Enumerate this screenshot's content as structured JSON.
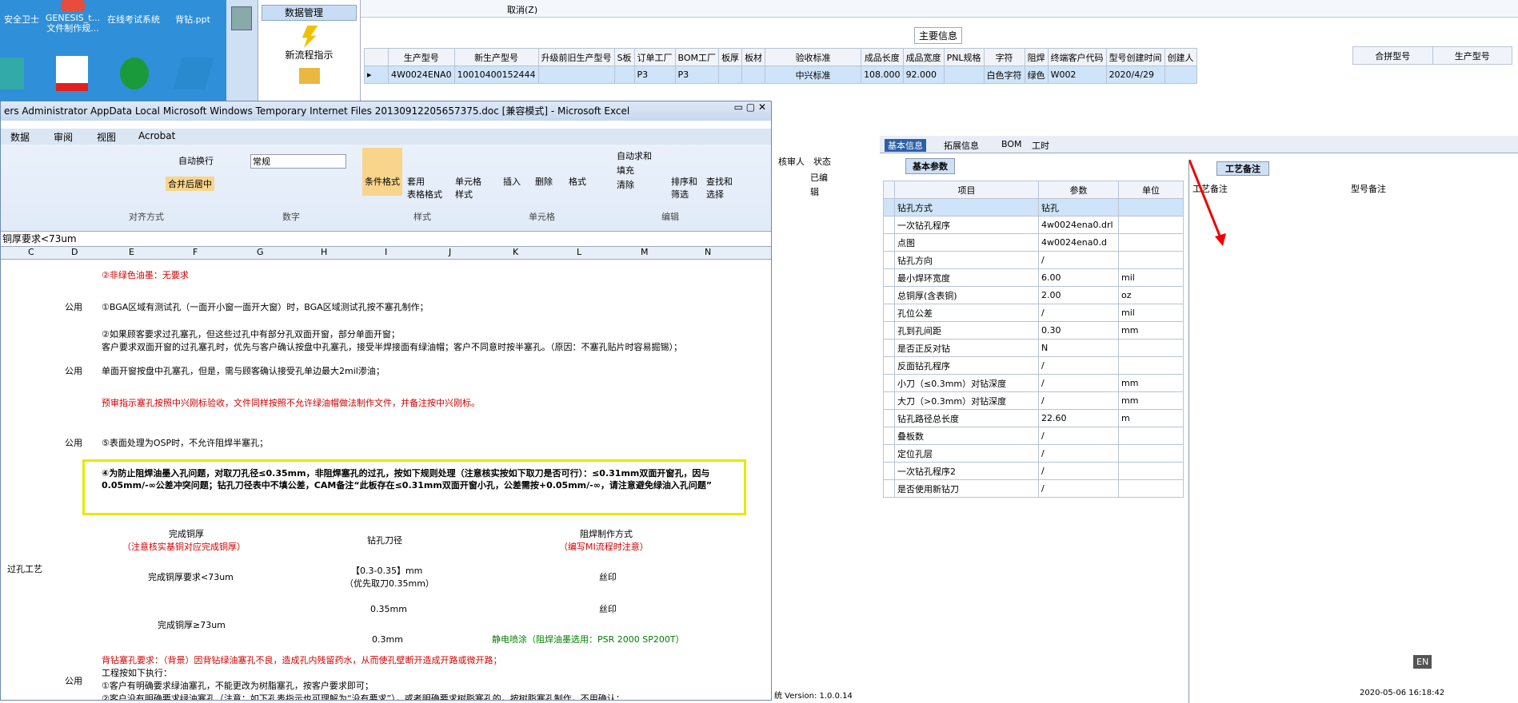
{
  "desktop": {
    "icons": [
      {
        "label": "安全卫士"
      },
      {
        "label": "GENESIS_t... 文件制作规..."
      },
      {
        "label": "在线考试系统"
      },
      {
        "label": "背钻.ppt"
      }
    ]
  },
  "left_panel": {
    "title": "数据管理",
    "item1": "新流程指示"
  },
  "toolbar": {
    "cancel": "取消(Z)"
  },
  "main": {
    "section_title": "主要信息",
    "columns": [
      "生产型号",
      "新生产型号",
      "升级前旧生产型号",
      "S板",
      "订单工厂",
      "BOM工厂",
      "板厚",
      "板材",
      "验收标准",
      "成品长度",
      "成品宽度",
      "PNL规格",
      "字符",
      "阻焊",
      "终端客户代码",
      "型号创建时间",
      "创建人"
    ],
    "row": [
      "4W0024ENA0",
      "10010400152444",
      "",
      "",
      "P3",
      "P3",
      "",
      "",
      "中兴标准",
      "108.000",
      "92.000",
      "",
      "白色字符",
      "绿色",
      "W002",
      "2020/4/29",
      ""
    ],
    "right_columns": [
      "合拼型号",
      "生产型号"
    ]
  },
  "excel": {
    "title": "ers Administrator AppData Local Microsoft Windows Temporary Internet Files 20130912205657375.doc [兼容模式] - Microsoft Excel",
    "menu": [
      "数据",
      "审阅",
      "视图",
      "Acrobat"
    ],
    "ribbon": {
      "wrap": "自动换行",
      "merge": "合并后居中",
      "align_group": "对齐方式",
      "number_format": "常规",
      "number_group": "数字",
      "cond_format": "条件格式",
      "table_format": "套用\n表格格式",
      "cell_style": "单元格\n样式",
      "style_group": "样式",
      "insert": "插入",
      "delete": "删除",
      "format": "格式",
      "cells_group": "单元格",
      "autosum": "自动求和",
      "fill": "填充",
      "clear": "清除",
      "sort": "排序和\n筛选",
      "find": "查找和\n选择",
      "edit_group": "编辑"
    },
    "formula": "铜厚要求<73um",
    "cols": [
      "C",
      "D",
      "E",
      "F",
      "G",
      "H",
      "I",
      "J",
      "K",
      "L",
      "M",
      "N"
    ],
    "rows": {
      "r1": "②非绿色油墨：无要求",
      "r2_cat": "公用",
      "r2": "①BGA区域有测试孔（一面开小窗一面开大窗）时，BGA区域测试孔按不塞孔制作；",
      "r3_cat": "公用",
      "r3a": "②如果顾客要求过孔塞孔，但这些过孔中有部分孔双面开窗，部分单面开窗；",
      "r3b": "客户要求双面开窗的过孔塞孔时，优先与客户确认按盘中孔塞孔，接受半焊接面有绿油帽；客户不同意时按半塞孔。（原因：不塞孔贴片时容易掘锡）；",
      "r3c": "单面开窗按盘中孔塞孔，但是，需与顾客确认接受孔单边最大2mil渗油；",
      "r3d": "预审指示塞孔按照中兴刚标验收，文件同样按照不允许绿油帽做法制作文件，并备注按中兴刚标。",
      "r4_cat": "公用",
      "r4": "⑤表面处理为OSP时，不允许阻焊半塞孔；",
      "group_cat": "过孔工艺",
      "r5": "④为防止阻焊油墨入孔问题，对取刀孔径≤0.35mm，非阻焊塞孔的过孔，按如下规则处理（注意核实按如下取刀是否可行）：≤0.31mm双面开窗孔，因与0.05mm/-∞公差冲突问题；钻孔刀径表中不填公差，CAM备注“此板存在≤0.31mm双面开窗小孔，公差需按+0.05mm/-∞，请注意避免绿油入孔问题”",
      "t_h1": "完成铜厚",
      "t_h1b": "（注意核实基铜对应完成铜厚）",
      "t_h2": "钻孔刀径",
      "t_h3": "阻焊制作方式",
      "t_h3b": "（编写MI流程时注意）",
      "t_r1a": "完成铜厚要求<73um",
      "t_r1b": "【0.3-0.35】mm",
      "t_r1c": "（优先取刀0.35mm）",
      "t_r1d": "丝印",
      "t_r2a": "完成铜厚≥73um",
      "t_r2b": "0.35mm",
      "t_r2d": "丝印",
      "t_r3b": "0.3mm",
      "t_r3d": "静电喷涂（阻焊油墨选用：PSR 2000 SP200T）",
      "r6_cat": "公用",
      "r6a": "背钻塞孔要求：（背景）因背钻绿油塞孔不良，造成孔内残留药水，从而使孔壁断开造成开路或微开路；",
      "r6b": "工程按如下执行：",
      "r6c": "①客户有明确要求绿油塞孔，不能更改为树脂塞孔，按客户要求即可；",
      "r6d": "②客户没有明确要求绿油塞孔（注意：如下孔表指示也可理解为“没有要求”），或者明确要求树脂塞孔的，按树脂塞孔制作，不用确认；"
    }
  },
  "status_col": {
    "header1": "核审人",
    "header2": "状态",
    "value": "已编辑"
  },
  "tabs": [
    "基本信息",
    "拓展信息",
    "BOM",
    "工时"
  ],
  "basic": {
    "subtab": "基本参数",
    "headers": [
      "项目",
      "参数",
      "单位"
    ],
    "rows": [
      [
        "钻孔方式",
        "钻孔",
        ""
      ],
      [
        "一次钻孔程序",
        "4w0024ena0.drl",
        ""
      ],
      [
        "点图",
        "4w0024ena0.d",
        ""
      ],
      [
        "钻孔方向",
        "/",
        ""
      ],
      [
        "最小焊环宽度",
        "6.00",
        "mil"
      ],
      [
        "总铜厚(含表铜)",
        "2.00",
        "oz"
      ],
      [
        "孔位公差",
        "/",
        "mil"
      ],
      [
        "孔到孔间距",
        "0.30",
        "mm"
      ],
      [
        "是否正反对钻",
        "N",
        ""
      ],
      [
        "反面钻孔程序",
        "/",
        ""
      ],
      [
        "小刀（≤0.3mm）对钻深度",
        "/",
        "mm"
      ],
      [
        "大刀（>0.3mm）对钻深度",
        "/",
        "mm"
      ],
      [
        "钻孔路径总长度",
        "22.60",
        "m"
      ],
      [
        "叠板数",
        "/",
        ""
      ],
      [
        "定位孔层",
        "/",
        ""
      ],
      [
        "一次钻孔程序2",
        "/",
        ""
      ],
      [
        "是否使用新钻刀",
        "/",
        ""
      ]
    ]
  },
  "craft": {
    "tab": "工艺备注",
    "col1": "工艺备注",
    "col2": "型号备注"
  },
  "status_bar": {
    "version": "统 Version: 1.0.0.14",
    "datetime": "2020-05-06 16:18:42"
  },
  "lang": "EN"
}
